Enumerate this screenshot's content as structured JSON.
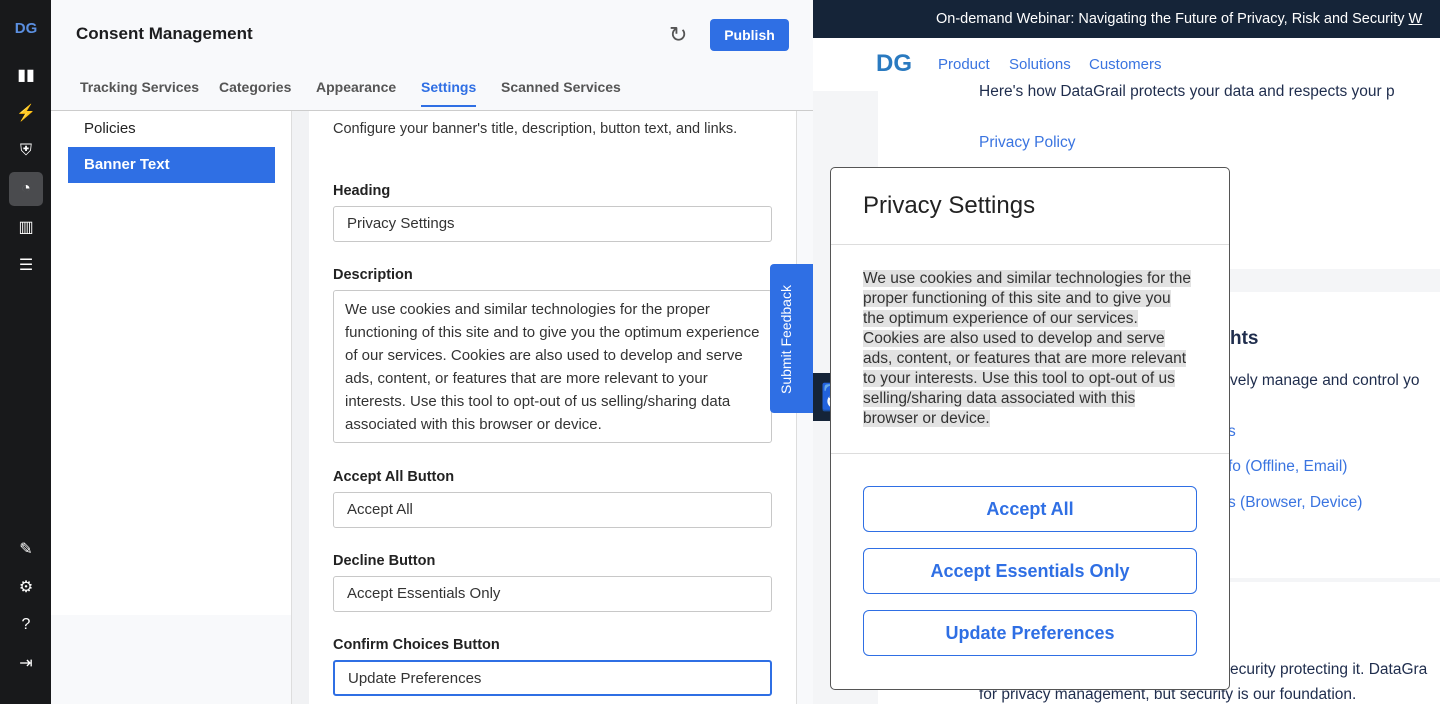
{
  "rail": {
    "icons": [
      "dg-logo-icon",
      "bar-chart-icon",
      "lightning-icon",
      "shield-search-icon",
      "cookie-icon",
      "map-icon",
      "checklist-icon",
      "magic-wand-icon",
      "gear-icon",
      "help-icon",
      "logout-icon"
    ],
    "active": "cookie-icon"
  },
  "header": {
    "title": "Consent Management",
    "publish": "Publish"
  },
  "tabs": [
    "Tracking Services",
    "Categories",
    "Appearance",
    "Settings",
    "Scanned Services"
  ],
  "active_tab": "Settings",
  "sidebar": {
    "items": [
      "Policies",
      "Banner Text"
    ],
    "active": "Banner Text"
  },
  "form": {
    "intro": "Configure your banner's title, description, button text, and links.",
    "heading_label": "Heading",
    "heading_value": "Privacy Settings",
    "description_label": "Description",
    "description_value": "We use cookies and similar technologies for the proper functioning of this site and to give you the optimum experience of our services. Cookies are also used to develop and serve ads, content, or features that are more relevant to your interests. Use this tool to opt-out of us selling/sharing data associated with this browser or device.",
    "accept_label": "Accept All Button",
    "accept_value": "Accept All",
    "decline_label": "Decline Button",
    "decline_value": "Accept Essentials Only",
    "confirm_label": "Confirm Choices Button",
    "confirm_value": "Update Preferences"
  },
  "site": {
    "banner": "On-demand Webinar: Navigating the Future of Privacy, Risk and Security ",
    "banner_link": "W",
    "nav": [
      "Product",
      "Solutions",
      "Customers"
    ],
    "intro": "Here's how DataGrail protects your data and respects your p",
    "privacy_policy": "Privacy Policy",
    "rights_heading": "hts",
    "rights_text": "vely manage and control yo",
    "link1": "s",
    "link2": "fo (Offline, Email)",
    "link3": "s (Browser, Device)",
    "security1": "ecurity protecting it. DataGra",
    "security2": "for privacy management, but security is our foundation."
  },
  "feedback": "Submit Feedback",
  "modal": {
    "title": "Privacy Settings",
    "body": "We use cookies and similar technologies for the proper functioning of this site and to give you the optimum experience of our services. Cookies are also used to develop and serve ads, content, or features that are more relevant to your interests. Use this tool to opt-out of us selling/sharing data associated with this browser or device.",
    "buttons": [
      "Accept All",
      "Accept Essentials Only",
      "Update Preferences"
    ]
  },
  "colors": {
    "accent": "#2f6fe4",
    "rail": "#18191b",
    "site_banner": "#152438"
  }
}
